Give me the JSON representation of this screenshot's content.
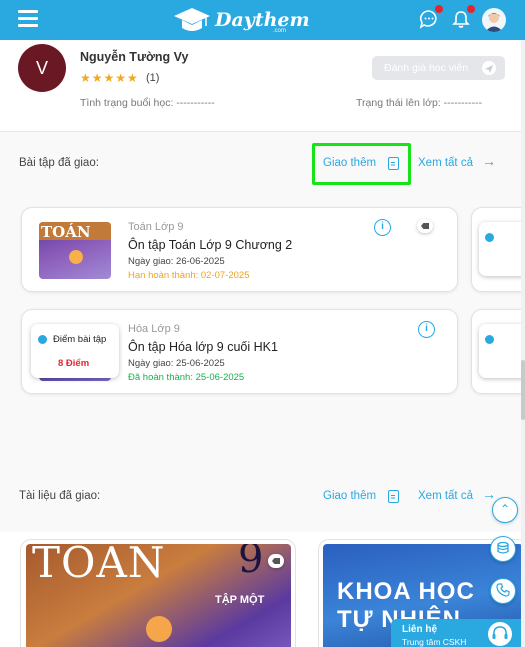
{
  "header": {
    "logo_text": "Daythem",
    "logo_sub": ".com",
    "icons": [
      "menu-icon",
      "chat-icon",
      "bell-icon",
      "user-avatar-icon"
    ],
    "brand_color": "#2aa8e0"
  },
  "profile": {
    "initial": "V",
    "name": "Nguyễn Tường Vy",
    "stars": "★★★★★",
    "rating_count": "(1)",
    "rate_button": "Đánh giá học viên",
    "status_label": "Tình trạng buổi học: -----------",
    "class_status_label": "Trạng thái lên lớp: -----------"
  },
  "assignments": {
    "title": "Bài tập đã giao:",
    "assign_more": "Giao thêm",
    "view_all": "Xem tất cả",
    "items": [
      {
        "subject": "Toán Lớp 9",
        "title": "Ôn tập Toán Lớp 9 Chương 2",
        "assigned": "Ngày giao: 26-06-2025",
        "due": "Hạn hoàn thành: 02-07-2025",
        "thumb_label": "TOÁN"
      },
      {
        "subject": "Hóa Lớp 9",
        "title": "Ôn tập Hóa lớp 9 cuối HK1",
        "assigned": "Ngày giao: 25-06-2025",
        "due": "Đã hoàn thành: 25-06-2025",
        "score_label": "Điểm bài tập",
        "score_value": "8 Điểm"
      }
    ]
  },
  "documents": {
    "title": "Tài liệu đã giao:",
    "assign_more": "Giao thêm",
    "view_all": "Xem tất cả",
    "items": [
      {
        "cover_title": "TOÁN",
        "cover_number": "9",
        "cover_sub": "TẬP MỘT"
      },
      {
        "cover_title": "KHOA HỌC",
        "cover_sub": "TỰ NHIÊN"
      }
    ]
  },
  "contact": {
    "title": "Liên hệ",
    "subtitle": "Trung tâm CSKH"
  }
}
